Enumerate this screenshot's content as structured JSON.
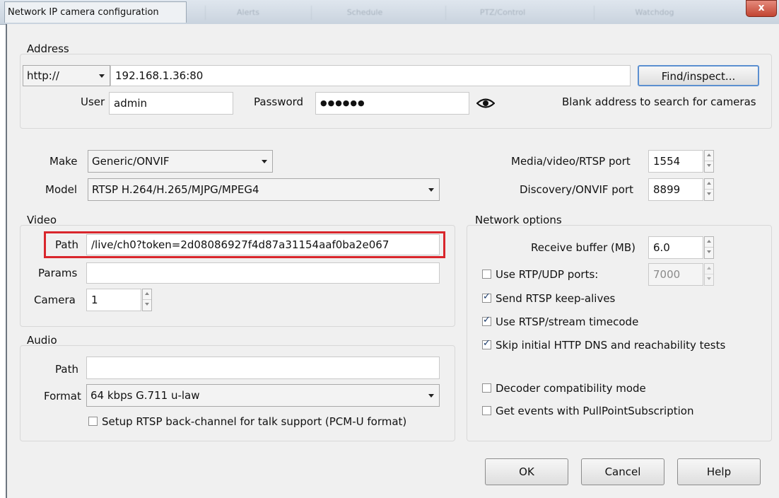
{
  "window": {
    "title": "Network IP camera configuration",
    "background_tabs": [
      "Alerts",
      "Schedule",
      "PTZ/Control",
      "Watchdog"
    ],
    "close_glyph": "x"
  },
  "address": {
    "group_label": "Address",
    "protocol": "http://",
    "host": "192.168.1.36:80",
    "find_button": "Find/inspect...",
    "user_label": "User",
    "user_value": "admin",
    "password_label": "Password",
    "password_mask": "●●●●●●",
    "reveal_icon": "eye-icon",
    "hint": "Blank address to search for cameras"
  },
  "device": {
    "make_label": "Make",
    "make_value": "Generic/ONVIF",
    "model_label": "Model",
    "model_value": "RTSP H.264/H.265/MJPG/MPEG4",
    "media_port_label": "Media/video/RTSP port",
    "media_port_value": "1554",
    "discovery_port_label": "Discovery/ONVIF port",
    "discovery_port_value": "8899"
  },
  "video": {
    "group_label": "Video",
    "path_label": "Path",
    "path_value": "/live/ch0?token=2d08086927f4d87a31154aaf0ba2e067",
    "params_label": "Params",
    "params_value": "",
    "camera_label": "Camera",
    "camera_value": "1",
    "highlight_color": "#d9262c"
  },
  "audio": {
    "group_label": "Audio",
    "path_label": "Path",
    "path_value": "",
    "format_label": "Format",
    "format_value": "64 kbps G.711 u-law",
    "backchannel_label": "Setup RTSP back-channel for talk support (PCM-U format)",
    "backchannel_checked": false
  },
  "network": {
    "group_label": "Network options",
    "receive_buffer_label": "Receive buffer (MB)",
    "receive_buffer_value": "6.0",
    "rtp_udp_label": "Use RTP/UDP ports:",
    "rtp_udp_checked": false,
    "rtp_udp_value": "7000",
    "keepalive_label": "Send RTSP keep-alives",
    "keepalive_checked": true,
    "timecode_label": "Use RTSP/stream timecode",
    "timecode_checked": true,
    "skip_dns_label": "Skip initial HTTP DNS and reachability tests",
    "skip_dns_checked": true,
    "decoder_compat_label": "Decoder compatibility mode",
    "decoder_compat_checked": false,
    "pullpoint_label": "Get events with PullPointSubscription",
    "pullpoint_checked": false
  },
  "buttons": {
    "ok": "OK",
    "cancel": "Cancel",
    "help": "Help"
  }
}
